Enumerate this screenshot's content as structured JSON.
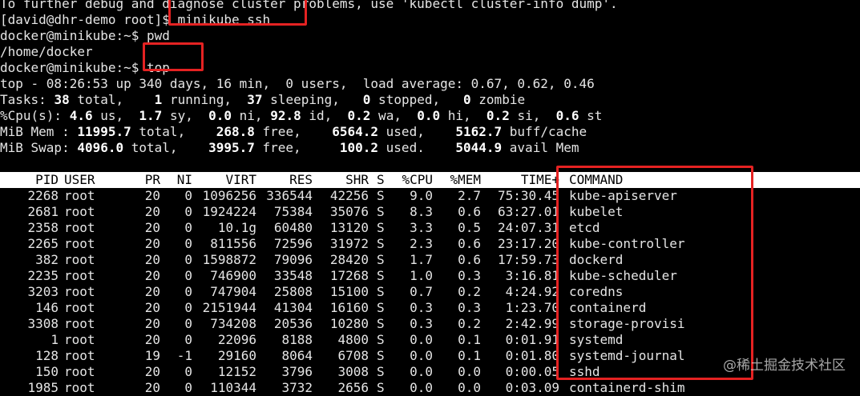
{
  "terminal": {
    "line0": "To further debug and diagnose cluster problems, use 'kubectl cluster-info dump'.",
    "line1_prompt": "[david@dhr-demo root]$ ",
    "line1_cmd": "minikube ssh",
    "line2": "docker@minikube:~$ pwd",
    "line3": "/home/docker",
    "line4_prompt": "docker@minikube:~$ ",
    "line4_cmd": "top"
  },
  "top_summary": {
    "uptime_line": "top - 08:26:53 up 340 days, 16 min,  0 users,  load average: 0.67, 0.62, 0.46",
    "tasks": {
      "label": "Tasks: ",
      "total": "38",
      "running": "1",
      "sleeping": "37",
      "stopped": "0",
      "zombie": "0"
    },
    "cpu": {
      "label": "%Cpu(s): ",
      "us": "4.6",
      "sy": "1.7",
      "ni": "0.0",
      "id": "92.8",
      "wa": "0.2",
      "hi": "0.0",
      "si": "0.2",
      "st": "0.6"
    },
    "mem": {
      "label": "MiB Mem : ",
      "total": "11995.7",
      "free": "268.8",
      "used": "6564.2",
      "buff_cache": "5162.7"
    },
    "swap": {
      "label": "MiB Swap: ",
      "total": "4096.0",
      "free": "3995.7",
      "used": "100.2",
      "avail": "5044.9"
    }
  },
  "process_table": {
    "headers": [
      "PID",
      "USER",
      "PR",
      "NI",
      "VIRT",
      "RES",
      "SHR",
      "S",
      "%CPU",
      "%MEM",
      "TIME+",
      "COMMAND"
    ],
    "rows": [
      [
        "2268",
        "root",
        "20",
        "0",
        "1096256",
        "336544",
        "42256",
        "S",
        "9.0",
        "2.7",
        "75:30.45",
        "kube-apiserver"
      ],
      [
        "2681",
        "root",
        "20",
        "0",
        "1924224",
        "75384",
        "35076",
        "S",
        "8.3",
        "0.6",
        "63:27.01",
        "kubelet"
      ],
      [
        "2358",
        "root",
        "20",
        "0",
        "10.1g",
        "60480",
        "13120",
        "S",
        "3.3",
        "0.5",
        "24:07.31",
        "etcd"
      ],
      [
        "2265",
        "root",
        "20",
        "0",
        "811556",
        "72596",
        "31972",
        "S",
        "2.3",
        "0.6",
        "23:17.20",
        "kube-controller"
      ],
      [
        "382",
        "root",
        "20",
        "0",
        "1598872",
        "79096",
        "28420",
        "S",
        "1.7",
        "0.6",
        "17:59.73",
        "dockerd"
      ],
      [
        "2235",
        "root",
        "20",
        "0",
        "746900",
        "33548",
        "17268",
        "S",
        "1.0",
        "0.3",
        "3:16.81",
        "kube-scheduler"
      ],
      [
        "3203",
        "root",
        "20",
        "0",
        "747904",
        "25808",
        "15100",
        "S",
        "0.7",
        "0.2",
        "4:24.92",
        "coredns"
      ],
      [
        "146",
        "root",
        "20",
        "0",
        "2151944",
        "41304",
        "16160",
        "S",
        "0.3",
        "0.3",
        "1:23.70",
        "containerd"
      ],
      [
        "3308",
        "root",
        "20",
        "0",
        "734208",
        "20536",
        "10280",
        "S",
        "0.3",
        "0.2",
        "2:42.99",
        "storage-provisi"
      ],
      [
        "1",
        "root",
        "20",
        "0",
        "22096",
        "8188",
        "4800",
        "S",
        "0.0",
        "0.1",
        "0:01.91",
        "systemd"
      ],
      [
        "128",
        "root",
        "19",
        "-1",
        "29160",
        "8064",
        "6708",
        "S",
        "0.0",
        "0.1",
        "0:01.80",
        "systemd-journal"
      ],
      [
        "150",
        "root",
        "20",
        "0",
        "12152",
        "3796",
        "3008",
        "S",
        "0.0",
        "0.0",
        "0:00.05",
        "sshd"
      ],
      [
        "1985",
        "root",
        "20",
        "0",
        "110344",
        "3732",
        "2656",
        "S",
        "0.0",
        "0.0",
        "0:03.09",
        "containerd-shim"
      ]
    ]
  },
  "watermark": "@稀土掘金技术社区",
  "colors": {
    "background": "#000000",
    "text": "#e5e5e5",
    "highlight_box": "#e52222",
    "header_bg": "#ffffff"
  }
}
